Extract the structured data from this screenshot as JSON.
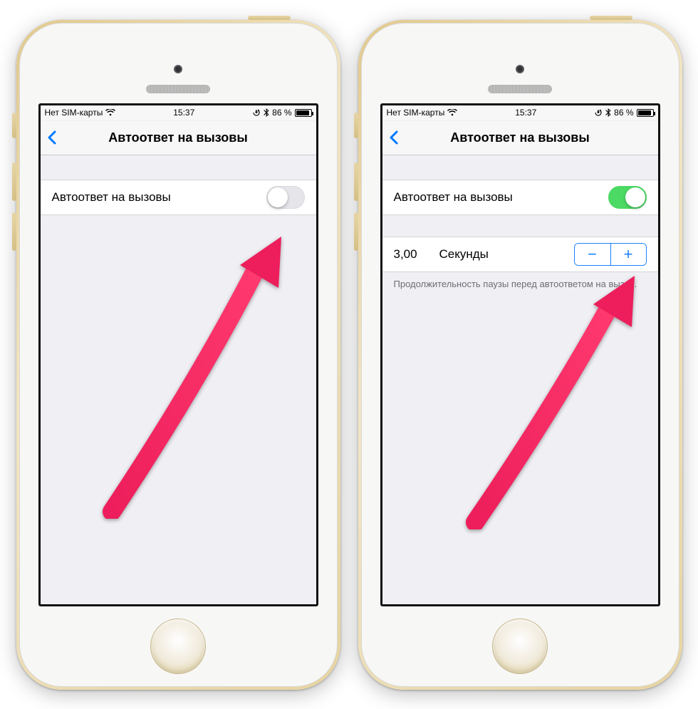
{
  "statusbar": {
    "carrier": "Нет SIM-карты",
    "time": "15:37",
    "battery_pct": "86 %",
    "battery_fill_pct": 86,
    "lock_icon": "⟳",
    "bt_icon": "✶"
  },
  "nav": {
    "title": "Автоответ на вызовы"
  },
  "left": {
    "toggle_label": "Автоответ на вызовы",
    "toggle_on": false
  },
  "right": {
    "toggle_label": "Автоответ на вызовы",
    "toggle_on": true,
    "seconds_value": "3,00",
    "seconds_unit": "Секунды",
    "minus": "−",
    "plus": "+",
    "footnote": "Продолжительность паузы перед автоответом на вызов."
  },
  "colors": {
    "accent": "#007aff",
    "toggle_on": "#4cd964",
    "arrow": "#ed1e5b"
  }
}
